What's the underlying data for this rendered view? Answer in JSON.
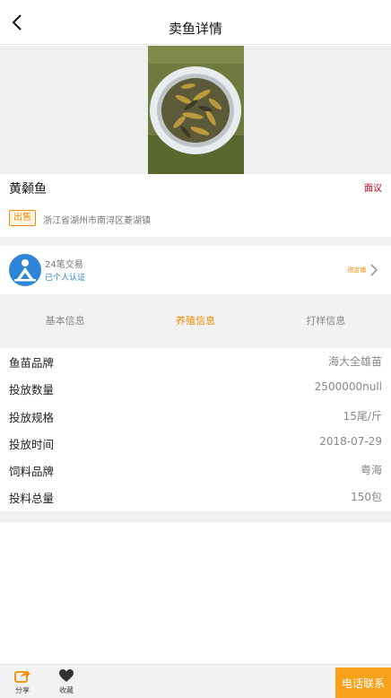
{
  "header": {
    "title": "卖鱼详情",
    "back_icon": "chevron-left-icon"
  },
  "product": {
    "name": "黄颡鱼",
    "objection_label": "面议",
    "tag": "出售",
    "location": "浙江省湖州市南浔区菱湖镇"
  },
  "seller": {
    "trades": "24笔交易",
    "verification": "已个人认证",
    "link_label": "进店铺"
  },
  "tabs": [
    {
      "label": "基本信息",
      "active": false
    },
    {
      "label": "养殖信息",
      "active": true
    },
    {
      "label": "打样信息",
      "active": false
    }
  ],
  "details": [
    {
      "label": "鱼苗品牌",
      "value": "海大全雄苗"
    },
    {
      "label": "投放数量",
      "value": "2500000null"
    },
    {
      "label": "投放规格",
      "value": "15尾/斤"
    },
    {
      "label": "投放时间",
      "value": "2018-07-29"
    },
    {
      "label": "饲料品牌",
      "value": "粤海"
    },
    {
      "label": "投料总量",
      "value": "150包"
    }
  ],
  "bottom": {
    "share_label": "分享",
    "favorite_label": "收藏",
    "call_label": "电话联系"
  },
  "colors": {
    "accent": "#f28c00",
    "call_button": "#f7a21b",
    "objection": "#d0021b",
    "verify": "#2f7fd8"
  }
}
